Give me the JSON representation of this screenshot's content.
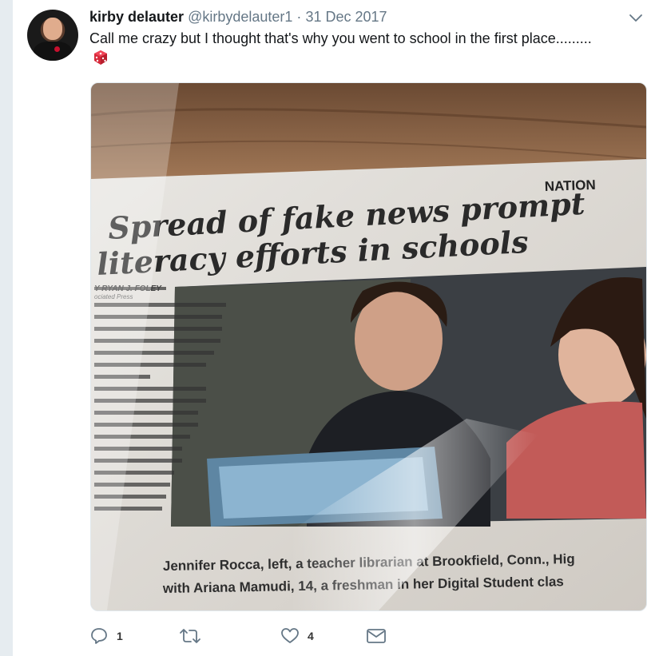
{
  "tweet": {
    "name": "kirby delauter",
    "handle": "@kirbydelauter1",
    "separator": "·",
    "date": "31 Dec 2017",
    "text": "Call me crazy but I thought that's why you went to school in the first place.........",
    "emoji": "game-die",
    "photo": {
      "section_label": "NATION",
      "headline_line1": "Spread of fake news prompt",
      "headline_line2": "literacy efforts in schools",
      "byline": "Y RYAN J. FOLEY",
      "byline2": "ociated Press",
      "caption_line1": "Jennifer Rocca, left, a teacher librarian at Brookfield, Conn., Hig",
      "caption_line2": "with Ariana Mamudi, 14, a freshman in her Digital Student clas"
    },
    "actions": {
      "reply_count": "1",
      "retweet_count": "",
      "like_count": "4"
    }
  },
  "colors": {
    "text_primary": "#14171a",
    "text_secondary": "#657786",
    "background": "#e6ecf0"
  }
}
